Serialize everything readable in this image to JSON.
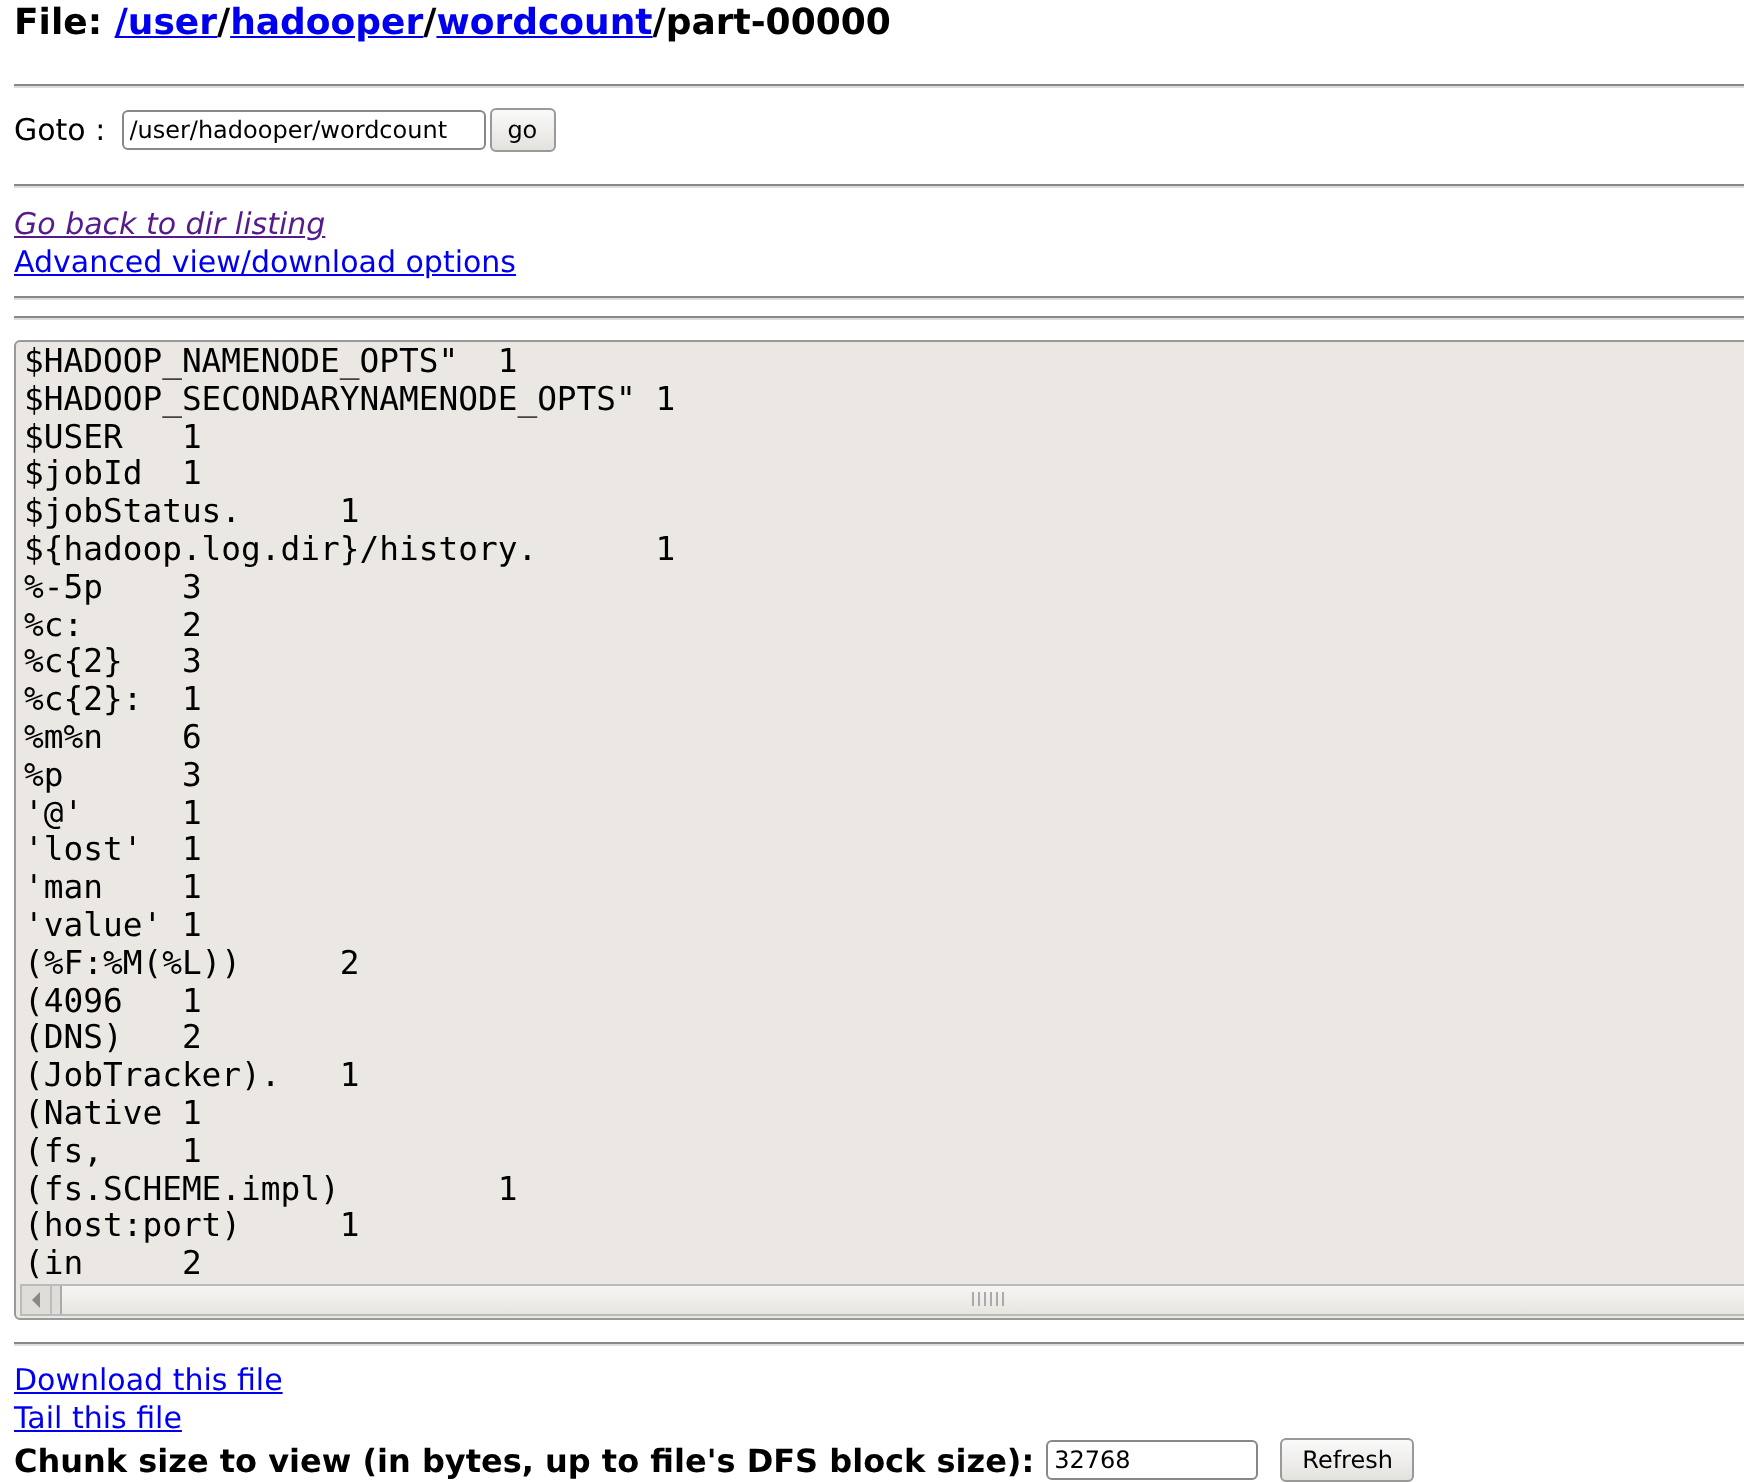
{
  "title": {
    "prefix": "File: ",
    "segments": [
      {
        "text": "/user",
        "kind": "link"
      },
      {
        "text": "/",
        "kind": "text"
      },
      {
        "text": "hadooper",
        "kind": "link"
      },
      {
        "text": "/",
        "kind": "text"
      },
      {
        "text": "wordcount",
        "kind": "link"
      },
      {
        "text": "/part-00000",
        "kind": "text"
      }
    ]
  },
  "goto": {
    "label": "Goto :",
    "value": "/user/hadooper/wordcount",
    "button": "go"
  },
  "links": [
    {
      "text": "Go back to dir listing",
      "visited": true
    },
    {
      "text": "Advanced view/download options",
      "visited": false
    }
  ],
  "content": {
    "lines": [
      "$HADOOP_NAMENODE_OPTS\"\t1",
      "$HADOOP_SECONDARYNAMENODE_OPTS\" 1",
      "$USER\t1",
      "$jobId\t1",
      "$jobStatus.\t1",
      "${hadoop.log.dir}/history.\t1",
      "%-5p\t3",
      "%c:\t2",
      "%c{2}\t3",
      "%c{2}:\t1",
      "%m%n\t6",
      "%p\t3",
      "'@'\t1",
      "'lost'\t1",
      "'man\t1",
      "'value'\t1",
      "(%F:%M(%L))\t2",
      "(4096\t1",
      "(DNS)\t2",
      "(JobTracker).\t1",
      "(Native\t1",
      "(fs,\t1",
      "(fs.SCHEME.impl)\t1",
      "(host:port)\t1",
      "(in\t2"
    ]
  },
  "bottom_links": [
    {
      "text": "Download this file",
      "visited": false
    },
    {
      "text": "Tail this file",
      "visited": false
    }
  ],
  "chunk": {
    "label": "Chunk size to view (in bytes, up to file's DFS block size):",
    "value": "32768",
    "button": "Refresh"
  }
}
